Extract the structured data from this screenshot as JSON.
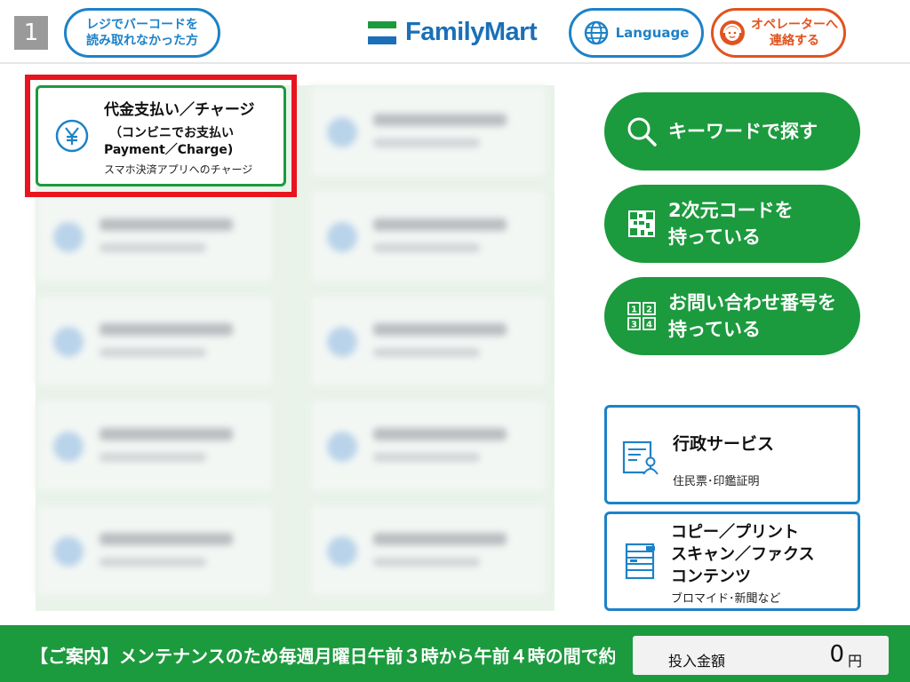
{
  "header": {
    "station_number": "1",
    "barcode_button": {
      "line1": "レジでバーコードを",
      "line2": "読み取れなかった方"
    },
    "logo_text": "FamilyMart",
    "language_button": "Language",
    "operator_button": {
      "line1": "オペレーターへ",
      "line2": "連絡する"
    }
  },
  "payment_card": {
    "title": "代金支払い／チャージ",
    "subtitle1": "（コンビニでお支払い",
    "subtitle2": "Payment／Charge)",
    "note": "スマホ決済アプリへのチャージ",
    "icon": "yen-icon"
  },
  "right_buttons": {
    "keyword": {
      "label": "キーワードで探す",
      "icon": "search-icon"
    },
    "qr": {
      "line1": "2次元コードを",
      "line2": "持っている",
      "icon": "qr-code-icon"
    },
    "inquiry": {
      "line1": "お問い合わせ番号を",
      "line2": "持っている",
      "icon": "number-keypad-icon"
    }
  },
  "service_cards": {
    "government": {
      "title": "行政サービス",
      "subtitle": "住民票･印鑑証明",
      "icon": "document-person-icon"
    },
    "copy": {
      "line1": "コピー／プリント",
      "line2": "スキャン／ファクス",
      "line3": "コンテンツ",
      "subtitle": "ブロマイド･新聞など",
      "icon": "copier-icon"
    }
  },
  "footer": {
    "announcement": "【ご案内】メンテナンスのため毎週月曜日午前３時から午前４時の間で約",
    "amount_label": "投入金額",
    "amount_value": "0",
    "amount_unit": "円"
  },
  "colors": {
    "brand_green": "#1c9a3e",
    "brand_blue": "#1d82c8",
    "operator_orange": "#e1531e",
    "highlight_red": "#e8141e"
  }
}
